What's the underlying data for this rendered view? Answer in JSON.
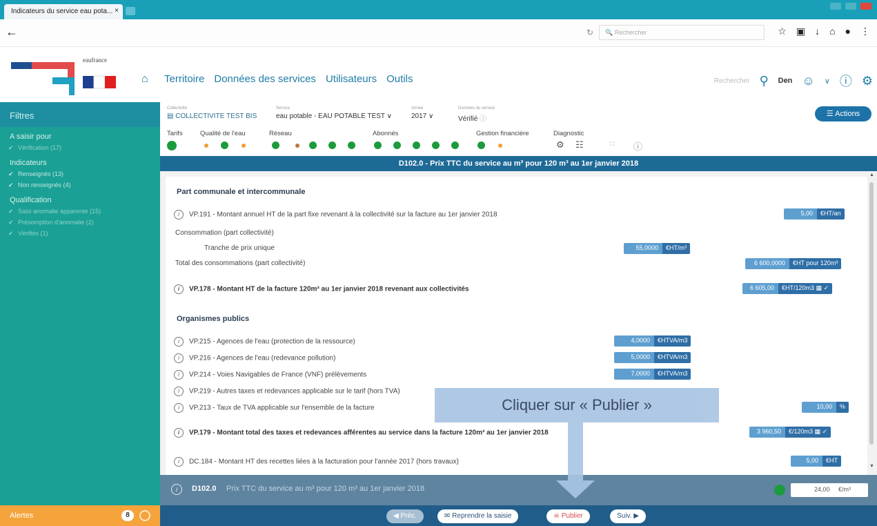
{
  "browser": {
    "tab_title": "Indicateurs du service eau pota...",
    "tab_close": "×",
    "search_placeholder": "Rechercher"
  },
  "header": {
    "logo_text": "eaufrance",
    "nav": [
      "Territoire",
      "Données des services",
      "Utilisateurs",
      "Outils"
    ],
    "search_label": "Rechercher",
    "user": "Den"
  },
  "sidebar": {
    "title": "Filtres",
    "sections": [
      {
        "label": "A saisir pour",
        "items": [
          {
            "label": "Vérification (17)"
          }
        ]
      },
      {
        "label": "Indicateurs",
        "items": [
          {
            "label": "Renseignés (13)"
          },
          {
            "label": "Non renseignés (4)"
          }
        ]
      },
      {
        "label": "Qualification",
        "items": [
          {
            "label": "Saisi anomalie apparente (15)"
          },
          {
            "label": "Présomption d'anomalie (2)"
          },
          {
            "label": "Vérifiés (1)"
          }
        ]
      }
    ],
    "alerts_label": "Alertes",
    "alerts_count": "8"
  },
  "context": {
    "collectivite_label": "Collectivité",
    "collectivite": "COLLECTIVITE TEST BIS",
    "service_label": "Service",
    "service": "eau potable - EAU POTABLE TEST",
    "annee_label": "Année",
    "annee": "2017",
    "donnees_label": "Données du service",
    "donnees": "Vérifié",
    "actions": "Actions",
    "categories": [
      "Tarifs",
      "Qualité de l'eau",
      "Réseau",
      "Abonnés",
      "Gestion financière",
      "Diagnostic"
    ]
  },
  "indicator": {
    "banner": "D102.0 - Prix TTC du service au m³ pour 120 m³ au 1er janvier 2018"
  },
  "section1": {
    "title": "Part communale et intercommunale",
    "vp191_label": "VP.191 - Montant annuel HT de la part fixe revenant à la collectivité sur la facture au 1er janvier 2018",
    "vp191_value": "5,00",
    "vp191_unit": "€HT/an",
    "conso_label": "Consommation (part collectivité)",
    "tranche_label": "Tranche de prix unique",
    "tranche_value": "55,0000",
    "tranche_unit": "€HT/m³",
    "total_label": "Total des consommations (part collectivité)",
    "total_value": "6 600,0000",
    "total_unit": "€HT pour 120m³",
    "vp178_label": "VP.178 - Montant HT de la facture 120m³ au 1er janvier 2018 revenant aux collectivités",
    "vp178_value": "6 605,00",
    "vp178_unit": "€HT/120m3"
  },
  "section2": {
    "title": "Organismes publics",
    "rows": [
      {
        "label": "VP.215 - Agences de l'eau (protection de la ressource)",
        "value": "4,0000",
        "unit": "€HTVA/m3"
      },
      {
        "label": "VP.216 - Agences de l'eau (redevance pollution)",
        "value": "5,0000",
        "unit": "€HTVA/m3"
      },
      {
        "label": "VP.214 - Voies Navigables de France (VNF) prélèvements",
        "value": "7,0000",
        "unit": "€HTVA/m3"
      },
      {
        "label": "VP.219 - Autres taxes et redevances applicable sur le tarif (hors TVA)",
        "value": "",
        "unit": ""
      }
    ],
    "vp213_label": "VP.213 - Taux de TVA applicable sur l'ensemble de la facture",
    "vp213_value": "10,00",
    "vp213_unit": "%",
    "vp179_label": "VP.179 - Montant total des taxes et redevances afférentes au service dans la facture 120m³ au 1er janvier 2018",
    "vp179_value": "3 960,50",
    "vp179_unit": "€/120m3",
    "dc184_label": "DC.184 - Montant HT des recettes liées à la facturation pour l'année 2017 (hors travaux)",
    "dc184_value": "5,00",
    "dc184_unit": "€HT"
  },
  "footer_indicator": {
    "code": "D102.0",
    "label": "Prix TTC du service au m³ pour 120 m³ au 1er janvier 2018",
    "value": "24,00",
    "unit": "€/m³"
  },
  "actionbar": {
    "prev": "Préc.",
    "resume": "Reprendre la saisie",
    "publish": "Publier",
    "next": "Suiv."
  },
  "callout": {
    "text": "Cliquer sur « Publier »"
  },
  "colors": {
    "sidebar": "#1aa094",
    "banner": "#1e6a97",
    "alerts": "#f5a33b",
    "status_green": "#1b9b3c"
  }
}
